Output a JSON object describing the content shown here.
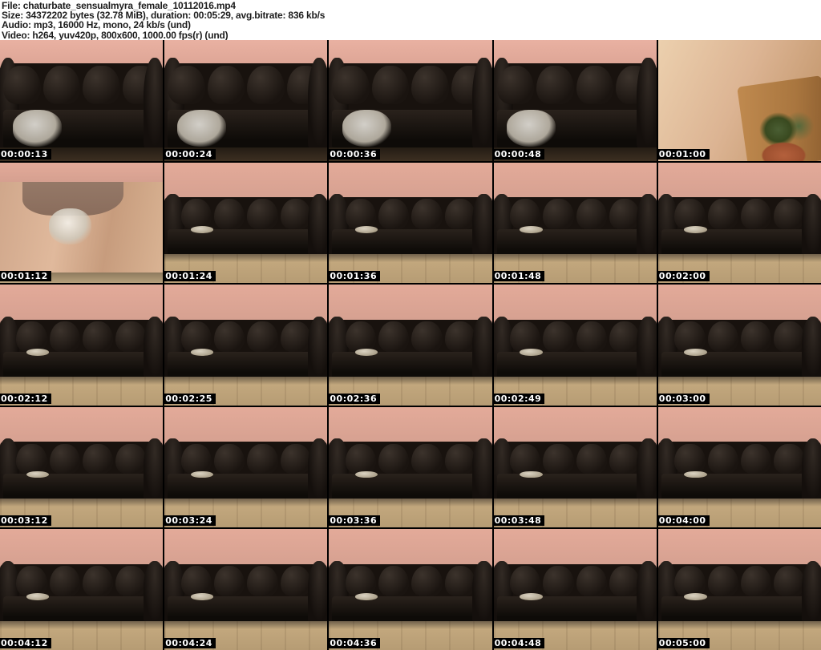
{
  "header": {
    "lines": [
      "File: chaturbate_sensualmyra_female_10112016.mp4",
      "Size: 34372202 bytes (32.78 MiB), duration: 00:05:29, avg.bitrate: 836 kb/s",
      "Audio: mp3, 16000 Hz, mono, 24 kb/s (und)",
      "Video: h264, yuv420p, 800x600, 1000.00 fps(r) (und)"
    ]
  },
  "colors": {
    "header_bg": "#ffffff",
    "header_text": "#1c1c1c",
    "wall_pink": "#d9a493",
    "couch_black": "#18120e",
    "floor_wood": "#b69c74",
    "timestamp_bg": "#000000",
    "timestamp_text": "#ffffff",
    "grid_gap": "#000000"
  },
  "thumbnails": [
    {
      "timestamp": "00:00:13",
      "scene": "closeup"
    },
    {
      "timestamp": "00:00:24",
      "scene": "closeup"
    },
    {
      "timestamp": "00:00:36",
      "scene": "closeup"
    },
    {
      "timestamp": "00:00:48",
      "scene": "closeup"
    },
    {
      "timestamp": "00:01:00",
      "scene": "skin"
    },
    {
      "timestamp": "00:01:12",
      "scene": "legs"
    },
    {
      "timestamp": "00:01:24",
      "scene": "wide"
    },
    {
      "timestamp": "00:01:36",
      "scene": "wide"
    },
    {
      "timestamp": "00:01:48",
      "scene": "wide"
    },
    {
      "timestamp": "00:02:00",
      "scene": "wide"
    },
    {
      "timestamp": "00:02:12",
      "scene": "wide"
    },
    {
      "timestamp": "00:02:25",
      "scene": "wide"
    },
    {
      "timestamp": "00:02:36",
      "scene": "wide"
    },
    {
      "timestamp": "00:02:49",
      "scene": "wide"
    },
    {
      "timestamp": "00:03:00",
      "scene": "wide"
    },
    {
      "timestamp": "00:03:12",
      "scene": "wide"
    },
    {
      "timestamp": "00:03:24",
      "scene": "wide"
    },
    {
      "timestamp": "00:03:36",
      "scene": "wide"
    },
    {
      "timestamp": "00:03:48",
      "scene": "wide"
    },
    {
      "timestamp": "00:04:00",
      "scene": "wide"
    },
    {
      "timestamp": "00:04:12",
      "scene": "wide"
    },
    {
      "timestamp": "00:04:24",
      "scene": "wide"
    },
    {
      "timestamp": "00:04:36",
      "scene": "wide"
    },
    {
      "timestamp": "00:04:48",
      "scene": "wide"
    },
    {
      "timestamp": "00:05:00",
      "scene": "wide"
    }
  ]
}
